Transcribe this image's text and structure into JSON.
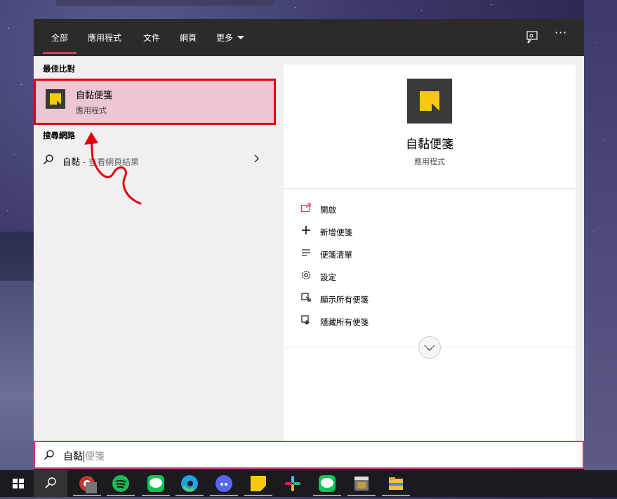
{
  "tabs": [
    {
      "label": "全部",
      "active": true
    },
    {
      "label": "應用程式",
      "active": false
    },
    {
      "label": "文件",
      "active": false
    },
    {
      "label": "網頁",
      "active": false
    },
    {
      "label": "更多",
      "active": false
    }
  ],
  "topbar_icons": [
    "feedback-icon",
    "more-options-icon"
  ],
  "more_dots": "···",
  "best_match": {
    "heading": "最佳比對",
    "title": "自黏便箋",
    "subtitle": "應用程式",
    "icon": "sticky-notes-icon"
  },
  "web_search": {
    "heading": "搜尋網路",
    "query": "自黏",
    "suffix": " - 查看網頁結果"
  },
  "detail": {
    "title": "自黏便箋",
    "subtitle": "應用程式",
    "actions": [
      {
        "label": "開啟",
        "icon": "open-icon"
      },
      {
        "label": "新增便箋",
        "icon": "plus-icon"
      },
      {
        "label": "便箋清單",
        "icon": "list-icon"
      },
      {
        "label": "設定",
        "icon": "settings-icon"
      },
      {
        "label": "顯示所有便箋",
        "icon": "show-all-icon"
      },
      {
        "label": "隱藏所有便箋",
        "icon": "hide-all-icon"
      }
    ]
  },
  "search": {
    "typed": "自黏",
    "completion": "便箋"
  },
  "taskbar": [
    "windows-start-icon",
    "search-icon",
    "chrome-icon",
    "spotify-icon",
    "line-icon",
    "edge-icon",
    "discord-icon",
    "sticky-notes-icon",
    "slack-icon",
    "line-icon",
    "video-editor-icon",
    "file-explorer-icon"
  ],
  "colors": {
    "accent": "#d23c5d",
    "highlight_border": "#e00010",
    "note_yellow": "#f7c90c"
  }
}
